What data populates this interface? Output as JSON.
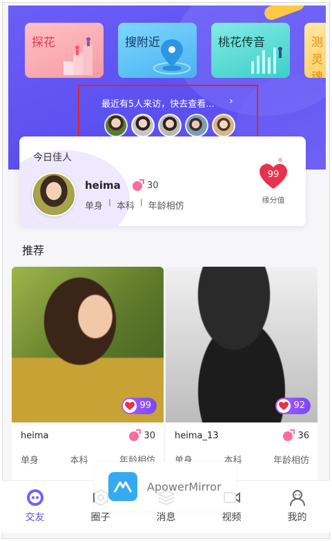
{
  "features": [
    {
      "label": "探花"
    },
    {
      "label": "搜附近"
    },
    {
      "label": "桃花传音"
    },
    {
      "label": "测灵魂"
    }
  ],
  "visitors": {
    "text": "最近有5人来访，快去查看...",
    "chevron": "›",
    "avatar_colors": [
      "#5a7b38",
      "#c9c6c3",
      "#bcbab7",
      "#7d9cb8",
      "#d9b587"
    ]
  },
  "today": {
    "title": "今日佳人",
    "name": "heima",
    "age": "30",
    "tags": [
      "单身",
      "本科",
      "年龄相仿"
    ],
    "tag_separator": "I",
    "fate_value": "99",
    "fate_label": "缘分值"
  },
  "recommend": {
    "section_title": "推荐",
    "items": [
      {
        "name": "heima",
        "age": "30",
        "score": "99",
        "tags": [
          "单身",
          "本科",
          "年龄相仿"
        ]
      },
      {
        "name": "heima_13",
        "age": "36",
        "score": "92",
        "tags": [
          "单身",
          "本科",
          "年龄相仿"
        ]
      }
    ]
  },
  "nav": [
    {
      "label": "交友",
      "icon": "friends-icon",
      "active": true
    },
    {
      "label": "圈子",
      "icon": "circle-icon",
      "active": false
    },
    {
      "label": "消息",
      "icon": "message-icon",
      "active": false
    },
    {
      "label": "视频",
      "icon": "video-icon",
      "active": false
    },
    {
      "label": "我的",
      "icon": "profile-icon",
      "active": false
    }
  ],
  "watermark": {
    "text": "ApowerMirror"
  },
  "colors": {
    "hero": "#5b4ff0",
    "accent": "#5b4ff0",
    "heart": "#e8324c",
    "score_pill": "#8a4ff5",
    "highlight_box": "#e0271f"
  }
}
